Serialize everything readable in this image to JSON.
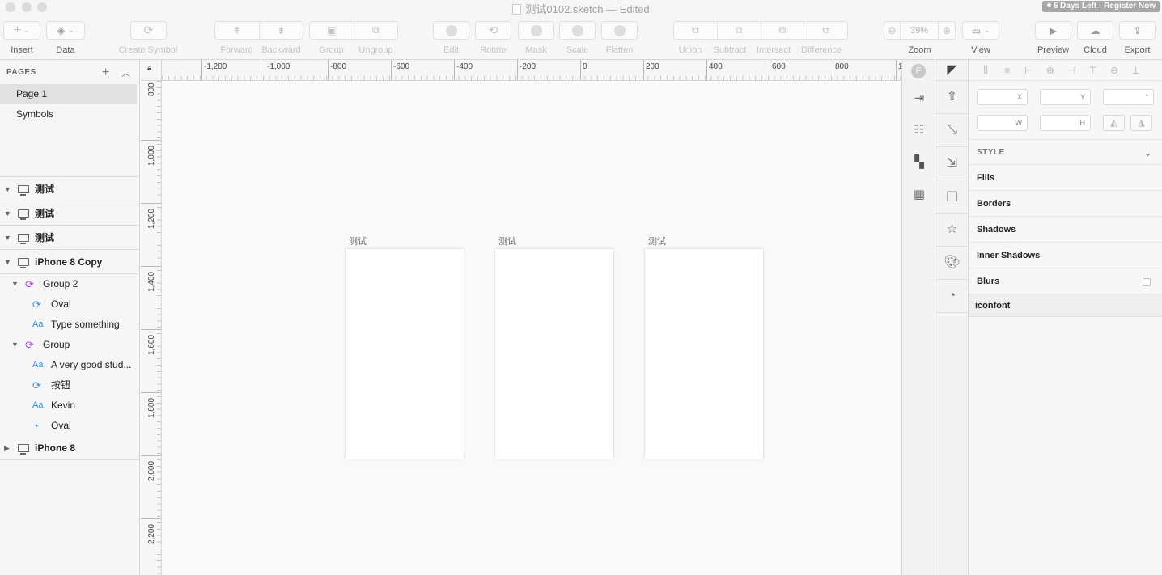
{
  "window": {
    "title": "测试0102.sketch",
    "status": "— Edited",
    "trial_badge": "5 Days Left - Register Now"
  },
  "toolbar": {
    "insert": "Insert",
    "data": "Data",
    "create_symbol": "Create Symbol",
    "forward": "Forward",
    "backward": "Backward",
    "group": "Group",
    "ungroup": "Ungroup",
    "edit": "Edit",
    "rotate": "Rotate",
    "mask": "Mask",
    "scale": "Scale",
    "flatten": "Flatten",
    "union": "Union",
    "subtract": "Subtract",
    "intersect": "Intersect",
    "difference": "Difference",
    "zoom_label": "Zoom",
    "zoom_value": "39%",
    "view": "View",
    "preview": "Preview",
    "cloud": "Cloud",
    "export": "Export"
  },
  "pages": {
    "header": "PAGES",
    "items": [
      "Page 1",
      "Symbols"
    ],
    "selected": "Page 1"
  },
  "layers": [
    {
      "name": "测试",
      "kind": "artboard",
      "expanded": true
    },
    {
      "name": "测试",
      "kind": "artboard",
      "expanded": true
    },
    {
      "name": "测试",
      "kind": "artboard",
      "expanded": true
    },
    {
      "name": "iPhone 8 Copy",
      "kind": "artboard",
      "expanded": true
    },
    {
      "name": "Group 2",
      "kind": "group",
      "expanded": true
    },
    {
      "name": "Oval",
      "kind": "symbol"
    },
    {
      "name": "Type something",
      "kind": "text"
    },
    {
      "name": "Group",
      "kind": "group",
      "expanded": true
    },
    {
      "name": "A very good stud...",
      "kind": "text"
    },
    {
      "name": "按钮",
      "kind": "symbol"
    },
    {
      "name": "Kevin",
      "kind": "text"
    },
    {
      "name": "Oval",
      "kind": "shape"
    },
    {
      "name": "iPhone 8",
      "kind": "artboard",
      "expanded": false
    }
  ],
  "rulers": {
    "horizontal": [
      "-1,200",
      "-1,000",
      "-800",
      "-600",
      "-400",
      "-200",
      "0",
      "200",
      "400",
      "600",
      "800",
      "1"
    ],
    "vertical": [
      "800",
      "1,000",
      "1,200",
      "1,400",
      "1,600",
      "1,800",
      "2,000",
      "2,200"
    ]
  },
  "canvas": {
    "artboards": [
      "测试",
      "测试",
      "测试"
    ]
  },
  "inspector": {
    "x_label": "X",
    "y_label": "Y",
    "rotation_label": "°",
    "w_label": "W",
    "h_label": "H",
    "style_header": "STYLE",
    "sections": [
      "Fills",
      "Borders",
      "Shadows",
      "Inner Shadows",
      "Blurs"
    ],
    "plugin_section": "iconfont"
  },
  "colors": {
    "symbol_icon": "#a64fd8",
    "text_icon": "#3a8ee6",
    "selected_page_bg": "#e1e1e1"
  }
}
